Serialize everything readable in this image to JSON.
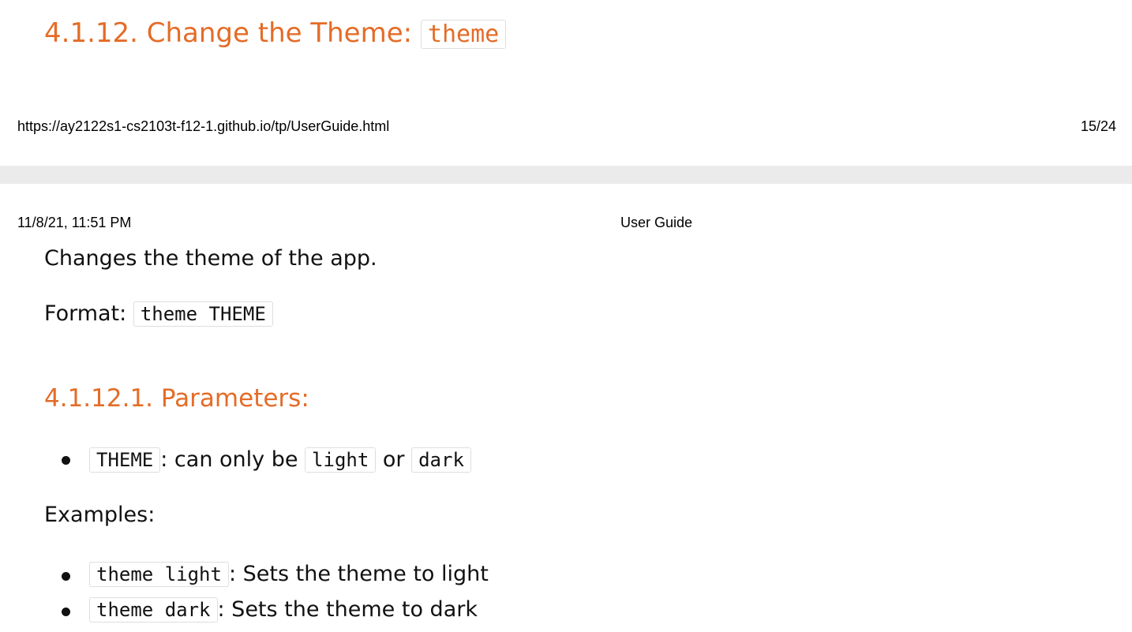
{
  "section": {
    "heading_text": "4.1.12. Change the Theme: ",
    "heading_code": "theme"
  },
  "footer": {
    "url": "https://ay2122s1-cs2103t-f12-1.github.io/tp/UserGuide.html",
    "page": "15/24"
  },
  "header": {
    "datetime": "11/8/21, 11:51 PM",
    "title": "User Guide"
  },
  "content": {
    "description": "Changes the theme of the app.",
    "format_label": "Format: ",
    "format_code": "theme THEME",
    "params_heading": "4.1.12.1. Parameters:",
    "params": [
      {
        "code": "THEME",
        "text1": ": can only be ",
        "code2": "light",
        "text2": " or ",
        "code3": "dark"
      }
    ],
    "examples_label": "Examples:",
    "examples": [
      {
        "code": "theme light",
        "text": ": Sets the theme to light"
      },
      {
        "code": "theme dark",
        "text": ": Sets the theme to dark"
      }
    ]
  }
}
